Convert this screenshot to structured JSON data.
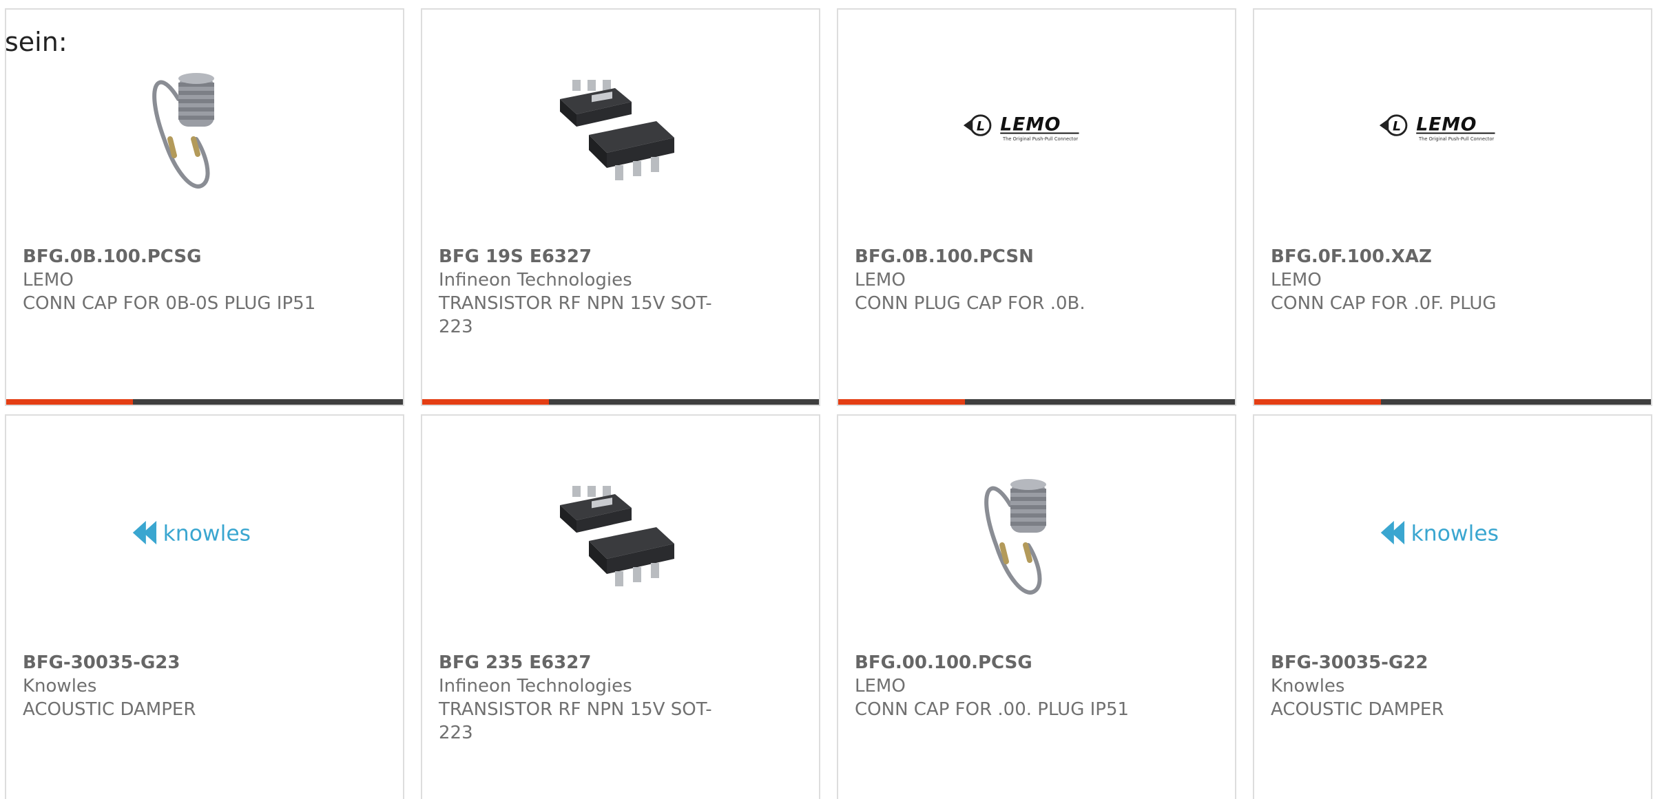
{
  "intro_text": "sein:",
  "colors": {
    "accent": "#e43e14",
    "bar_track": "#3f3f3f",
    "knowles_blue": "#3aa6d0"
  },
  "products": [
    {
      "part_number": "BFG.0B.100.PCSG",
      "manufacturer": "LEMO",
      "description": "CONN CAP FOR 0B-0S PLUG IP51",
      "image": "connector-cap-cable-image",
      "progress_fraction": 0.32
    },
    {
      "part_number": "BFG 19S E6327",
      "manufacturer": "Infineon Technologies",
      "description": "TRANSISTOR RF NPN 15V SOT-223",
      "image": "sot223-transistor-image",
      "progress_fraction": 0.32
    },
    {
      "part_number": "BFG.0B.100.PCSN",
      "manufacturer": "LEMO",
      "description": "CONN PLUG CAP FOR .0B.",
      "image": "lemo-logo",
      "logo_tagline": "The Original Push-Pull Connector",
      "progress_fraction": 0.32
    },
    {
      "part_number": "BFG.0F.100.XAZ",
      "manufacturer": "LEMO",
      "description": "CONN CAP FOR .0F. PLUG",
      "image": "lemo-logo",
      "logo_tagline": "The Original Push-Pull Connector",
      "progress_fraction": 0.32
    },
    {
      "part_number": "BFG-30035-G23",
      "manufacturer": "Knowles",
      "description": "ACOUSTIC DAMPER",
      "image": "knowles-logo"
    },
    {
      "part_number": "BFG 235 E6327",
      "manufacturer": "Infineon Technologies",
      "description": "TRANSISTOR RF NPN 15V SOT-223",
      "image": "sot223-transistor-image"
    },
    {
      "part_number": "BFG.00.100.PCSG",
      "manufacturer": "LEMO",
      "description": "CONN CAP FOR .00. PLUG IP51",
      "image": "connector-cap-cable-image"
    },
    {
      "part_number": "BFG-30035-G22",
      "manufacturer": "Knowles",
      "description": "ACOUSTIC DAMPER",
      "image": "knowles-logo"
    }
  ]
}
